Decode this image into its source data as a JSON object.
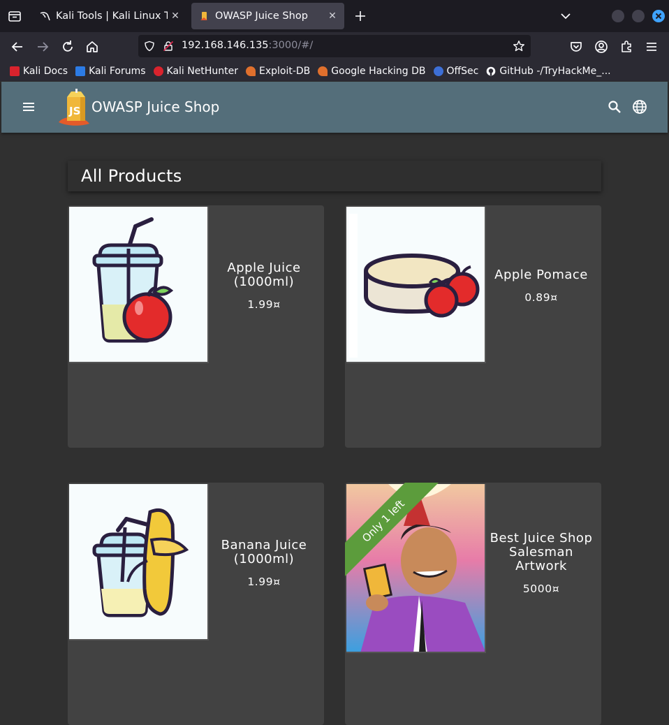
{
  "browser": {
    "tabs": [
      {
        "title": "Kali Tools | Kali Linux Tools",
        "active": false
      },
      {
        "title": "OWASP Juice Shop",
        "active": true
      }
    ],
    "url": {
      "host": "192.168.146.135",
      "rest": ":3000/#/"
    },
    "bookmarks": [
      {
        "label": "Kali Docs",
        "color": "#d9232d"
      },
      {
        "label": "Kali Forums",
        "color": "#2c7be5"
      },
      {
        "label": "Kali NetHunter",
        "color": "#d9232d"
      },
      {
        "label": "Exploit-DB",
        "color": "#e0702d"
      },
      {
        "label": "Google Hacking DB",
        "color": "#e0702d"
      },
      {
        "label": "OffSec",
        "color": "#3d6fd6"
      },
      {
        "label": "GitHub -/TryHackMe_...",
        "color": "#ffffff"
      }
    ]
  },
  "app": {
    "title": "OWASP Juice Shop",
    "toolbar_color": "#546e7a"
  },
  "main": {
    "heading": "All Products",
    "products": [
      {
        "name": "Apple Juice (1000ml)",
        "price": "1.99¤",
        "image": "apple-juice"
      },
      {
        "name": "Apple Pomace",
        "price": "0.89¤",
        "image": "apple-pomace"
      },
      {
        "name": "Banana Juice (1000ml)",
        "price": "1.99¤",
        "image": "banana-juice"
      },
      {
        "name": "Best Juice Shop Salesman Artwork",
        "price": "5000¤",
        "image": "salesman-artwork",
        "ribbon": "Only 1 left"
      }
    ]
  }
}
